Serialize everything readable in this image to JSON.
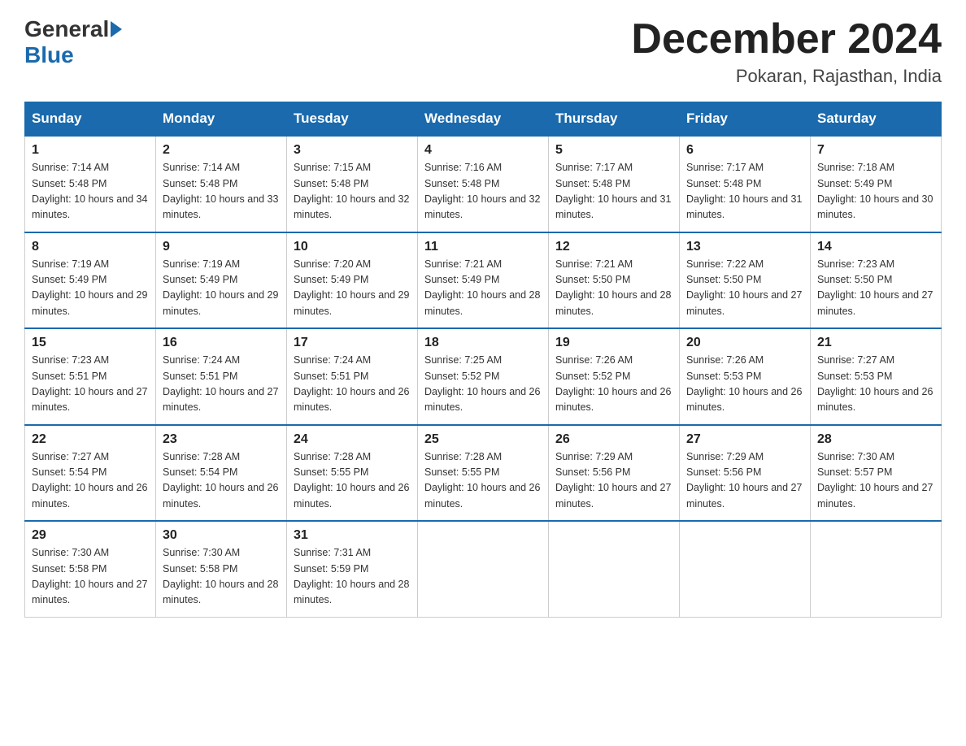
{
  "header": {
    "logo_general": "General",
    "logo_blue": "Blue",
    "month_year": "December 2024",
    "location": "Pokaran, Rajasthan, India"
  },
  "weekdays": [
    "Sunday",
    "Monday",
    "Tuesday",
    "Wednesday",
    "Thursday",
    "Friday",
    "Saturday"
  ],
  "weeks": [
    [
      {
        "day": "1",
        "sunrise": "7:14 AM",
        "sunset": "5:48 PM",
        "daylight": "10 hours and 34 minutes."
      },
      {
        "day": "2",
        "sunrise": "7:14 AM",
        "sunset": "5:48 PM",
        "daylight": "10 hours and 33 minutes."
      },
      {
        "day": "3",
        "sunrise": "7:15 AM",
        "sunset": "5:48 PM",
        "daylight": "10 hours and 32 minutes."
      },
      {
        "day": "4",
        "sunrise": "7:16 AM",
        "sunset": "5:48 PM",
        "daylight": "10 hours and 32 minutes."
      },
      {
        "day": "5",
        "sunrise": "7:17 AM",
        "sunset": "5:48 PM",
        "daylight": "10 hours and 31 minutes."
      },
      {
        "day": "6",
        "sunrise": "7:17 AM",
        "sunset": "5:48 PM",
        "daylight": "10 hours and 31 minutes."
      },
      {
        "day": "7",
        "sunrise": "7:18 AM",
        "sunset": "5:49 PM",
        "daylight": "10 hours and 30 minutes."
      }
    ],
    [
      {
        "day": "8",
        "sunrise": "7:19 AM",
        "sunset": "5:49 PM",
        "daylight": "10 hours and 29 minutes."
      },
      {
        "day": "9",
        "sunrise": "7:19 AM",
        "sunset": "5:49 PM",
        "daylight": "10 hours and 29 minutes."
      },
      {
        "day": "10",
        "sunrise": "7:20 AM",
        "sunset": "5:49 PM",
        "daylight": "10 hours and 29 minutes."
      },
      {
        "day": "11",
        "sunrise": "7:21 AM",
        "sunset": "5:49 PM",
        "daylight": "10 hours and 28 minutes."
      },
      {
        "day": "12",
        "sunrise": "7:21 AM",
        "sunset": "5:50 PM",
        "daylight": "10 hours and 28 minutes."
      },
      {
        "day": "13",
        "sunrise": "7:22 AM",
        "sunset": "5:50 PM",
        "daylight": "10 hours and 27 minutes."
      },
      {
        "day": "14",
        "sunrise": "7:23 AM",
        "sunset": "5:50 PM",
        "daylight": "10 hours and 27 minutes."
      }
    ],
    [
      {
        "day": "15",
        "sunrise": "7:23 AM",
        "sunset": "5:51 PM",
        "daylight": "10 hours and 27 minutes."
      },
      {
        "day": "16",
        "sunrise": "7:24 AM",
        "sunset": "5:51 PM",
        "daylight": "10 hours and 27 minutes."
      },
      {
        "day": "17",
        "sunrise": "7:24 AM",
        "sunset": "5:51 PM",
        "daylight": "10 hours and 26 minutes."
      },
      {
        "day": "18",
        "sunrise": "7:25 AM",
        "sunset": "5:52 PM",
        "daylight": "10 hours and 26 minutes."
      },
      {
        "day": "19",
        "sunrise": "7:26 AM",
        "sunset": "5:52 PM",
        "daylight": "10 hours and 26 minutes."
      },
      {
        "day": "20",
        "sunrise": "7:26 AM",
        "sunset": "5:53 PM",
        "daylight": "10 hours and 26 minutes."
      },
      {
        "day": "21",
        "sunrise": "7:27 AM",
        "sunset": "5:53 PM",
        "daylight": "10 hours and 26 minutes."
      }
    ],
    [
      {
        "day": "22",
        "sunrise": "7:27 AM",
        "sunset": "5:54 PM",
        "daylight": "10 hours and 26 minutes."
      },
      {
        "day": "23",
        "sunrise": "7:28 AM",
        "sunset": "5:54 PM",
        "daylight": "10 hours and 26 minutes."
      },
      {
        "day": "24",
        "sunrise": "7:28 AM",
        "sunset": "5:55 PM",
        "daylight": "10 hours and 26 minutes."
      },
      {
        "day": "25",
        "sunrise": "7:28 AM",
        "sunset": "5:55 PM",
        "daylight": "10 hours and 26 minutes."
      },
      {
        "day": "26",
        "sunrise": "7:29 AM",
        "sunset": "5:56 PM",
        "daylight": "10 hours and 27 minutes."
      },
      {
        "day": "27",
        "sunrise": "7:29 AM",
        "sunset": "5:56 PM",
        "daylight": "10 hours and 27 minutes."
      },
      {
        "day": "28",
        "sunrise": "7:30 AM",
        "sunset": "5:57 PM",
        "daylight": "10 hours and 27 minutes."
      }
    ],
    [
      {
        "day": "29",
        "sunrise": "7:30 AM",
        "sunset": "5:58 PM",
        "daylight": "10 hours and 27 minutes."
      },
      {
        "day": "30",
        "sunrise": "7:30 AM",
        "sunset": "5:58 PM",
        "daylight": "10 hours and 28 minutes."
      },
      {
        "day": "31",
        "sunrise": "7:31 AM",
        "sunset": "5:59 PM",
        "daylight": "10 hours and 28 minutes."
      },
      null,
      null,
      null,
      null
    ]
  ]
}
